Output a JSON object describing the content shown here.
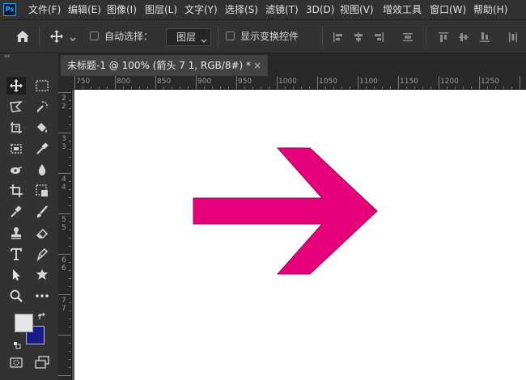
{
  "app": {
    "logo_text": "Ps"
  },
  "menu": [
    "文件(F)",
    "编辑(E)",
    "图像(I)",
    "图层(L)",
    "文字(Y)",
    "选择(S)",
    "滤镜(T)",
    "3D(D)",
    "视图(V)",
    "增效工具",
    "窗口(W)",
    "帮助(H)"
  ],
  "options": {
    "auto_select_label": "自动选择：",
    "layer_select_value": "图层",
    "show_transform_label": "显示变换控件"
  },
  "panel": {
    "collapse_glyph": "‹‹"
  },
  "document": {
    "tab_title": "未标题-1 @ 100% (箭头 7 1, RGB/8#) *",
    "close_glyph": "×"
  },
  "ruler": {
    "h_labels": [
      "750",
      "800",
      "850",
      "900",
      "950",
      "1000",
      "1050",
      "1100",
      "1150",
      "1200",
      "1250"
    ],
    "v_labels": [
      "2",
      "2",
      "3",
      "3",
      "4",
      "4",
      "5",
      "5",
      "6",
      "6",
      "7",
      "7"
    ]
  },
  "colors": {
    "arrow_fill": "#e5007a",
    "arrow_stroke": "#8a0a52",
    "foreground_swatch": "#e6e6e6",
    "background_swatch": "#1a1a8c"
  }
}
